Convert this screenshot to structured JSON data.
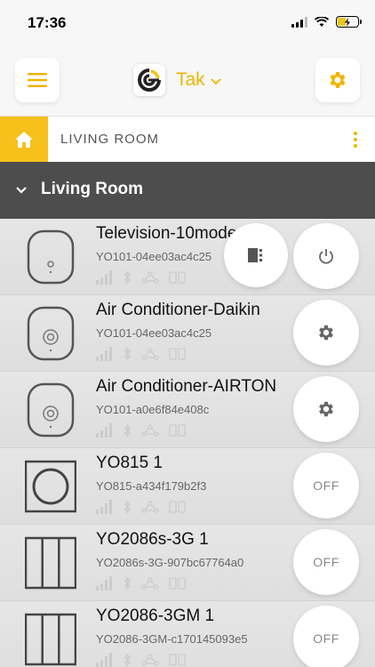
{
  "status_bar": {
    "time": "17:36"
  },
  "header": {
    "home_name": "Tak"
  },
  "breadcrumb": {
    "room": "LIVING ROOM"
  },
  "section": {
    "title": "Living Room"
  },
  "devices": [
    {
      "name": "Television-10mode",
      "id": "YO101-04ee03ac4c25",
      "type": "remote",
      "actions": [
        "remote-panel",
        "power"
      ]
    },
    {
      "name": "Air Conditioner-Daikin",
      "id": "YO101-04ee03ac4c25",
      "type": "remote",
      "actions": [
        "settings"
      ]
    },
    {
      "name": "Air Conditioner-AIRTON",
      "id": "YO101-a0e6f84e408c",
      "type": "remote",
      "actions": [
        "settings"
      ]
    },
    {
      "name": "YO815 1",
      "id": "YO815-a434f179b2f3",
      "type": "switch-round",
      "action_label": "OFF"
    },
    {
      "name": "YO2086s-3G 1",
      "id": "YO2086s-3G-907bc67764a0",
      "type": "switch-3gang",
      "action_label": "OFF"
    },
    {
      "name": "YO2086-3GM 1",
      "id": "YO2086-3GM-c170145093e5",
      "type": "switch-3gang",
      "action_label": "OFF"
    }
  ],
  "colors": {
    "accent": "#f5c11a",
    "section_bg": "#4d4d4d"
  }
}
